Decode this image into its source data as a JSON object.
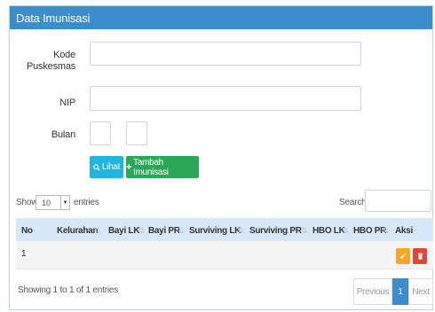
{
  "panel": {
    "title": "Data Imunisasi"
  },
  "form": {
    "kode_label_line1": "Kode",
    "kode_label_line2": "Puskesmas",
    "kode_value": "",
    "nip_label": "NIP",
    "nip_value": "",
    "bulan_label": "Bulan",
    "bulan_value_1": "",
    "bulan_value_2": ""
  },
  "buttons": {
    "lihat": "Lihat",
    "tambah": "Tambah Imunisasi"
  },
  "table_controls": {
    "show_label": "Show",
    "entries_value": "10",
    "entries_label": "entries",
    "search_label": "Search:",
    "search_value": ""
  },
  "table": {
    "columns": [
      "No",
      "Kelurahan",
      "Bayi LK",
      "Bayi PR",
      "Surviving LK",
      "Surviving PR",
      "HBO LK",
      "HBO PR",
      "Aksi"
    ],
    "rows": [
      {
        "no": "1"
      }
    ]
  },
  "footer": {
    "info": "Showing 1 to 1 of 1 entries",
    "previous": "Previous",
    "current_page": "1",
    "next": "Next"
  },
  "colors": {
    "header": "#3c8dcd",
    "table_header": "#d6e8f7",
    "lihat": "#1fb5e0",
    "tambah": "#2aa857",
    "edit": "#f5a623",
    "delete": "#e0443a",
    "active_page": "#3c8dcd"
  }
}
